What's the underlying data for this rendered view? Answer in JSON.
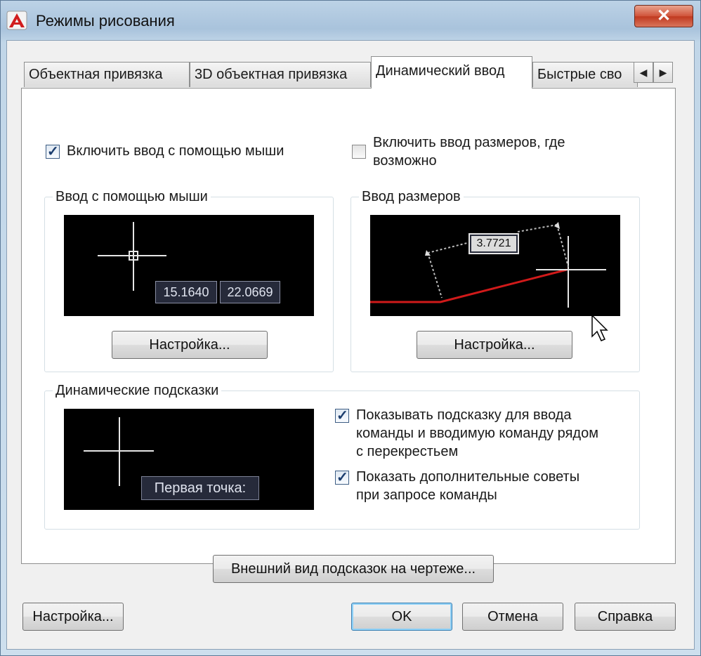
{
  "window": {
    "title": "Режимы рисования",
    "close_glyph": "✕"
  },
  "tabs": [
    {
      "label": "Объектная привязка"
    },
    {
      "label": "3D объектная привязка"
    },
    {
      "label": "Динамический ввод"
    },
    {
      "label": "Быстрые сво"
    }
  ],
  "tab_scroll": {
    "left": "◀",
    "right": "▶"
  },
  "panel": {
    "enable_pointer": {
      "label": "Включить ввод с помощью мыши",
      "checked": true
    },
    "enable_dimension": {
      "label_line1": "Включить ввод размеров, где",
      "label_line2": "возможно",
      "checked": false
    },
    "pointer_group": {
      "title": "Ввод с помощью мыши",
      "preview_x": "15.1640",
      "preview_y": "22.0669",
      "settings_button": "Настройка..."
    },
    "dimension_group": {
      "title": "Ввод размеров",
      "preview_value": "3.7721",
      "settings_button": "Настройка..."
    },
    "tooltips_group": {
      "title": "Динамические подсказки",
      "preview_prompt": "Первая точка:",
      "show_prompt": {
        "line1": "Показывать подсказку для ввода",
        "line2": "команды и вводимую команду рядом",
        "line3": "с перекрестьем",
        "checked": true
      },
      "show_tips": {
        "line1": "Показать дополнительные советы",
        "line2": "при запросе команды",
        "checked": true
      }
    },
    "appearance_button": "Внешний вид подсказок на чертеже..."
  },
  "footer": {
    "options_button": "Настройка...",
    "ok_button": "OK",
    "cancel_button": "Отмена",
    "help_button": "Справка"
  },
  "colors": {
    "accent": "#3c7fb1",
    "preview_bg": "#000000",
    "rubber_band": "#d01a1a"
  }
}
